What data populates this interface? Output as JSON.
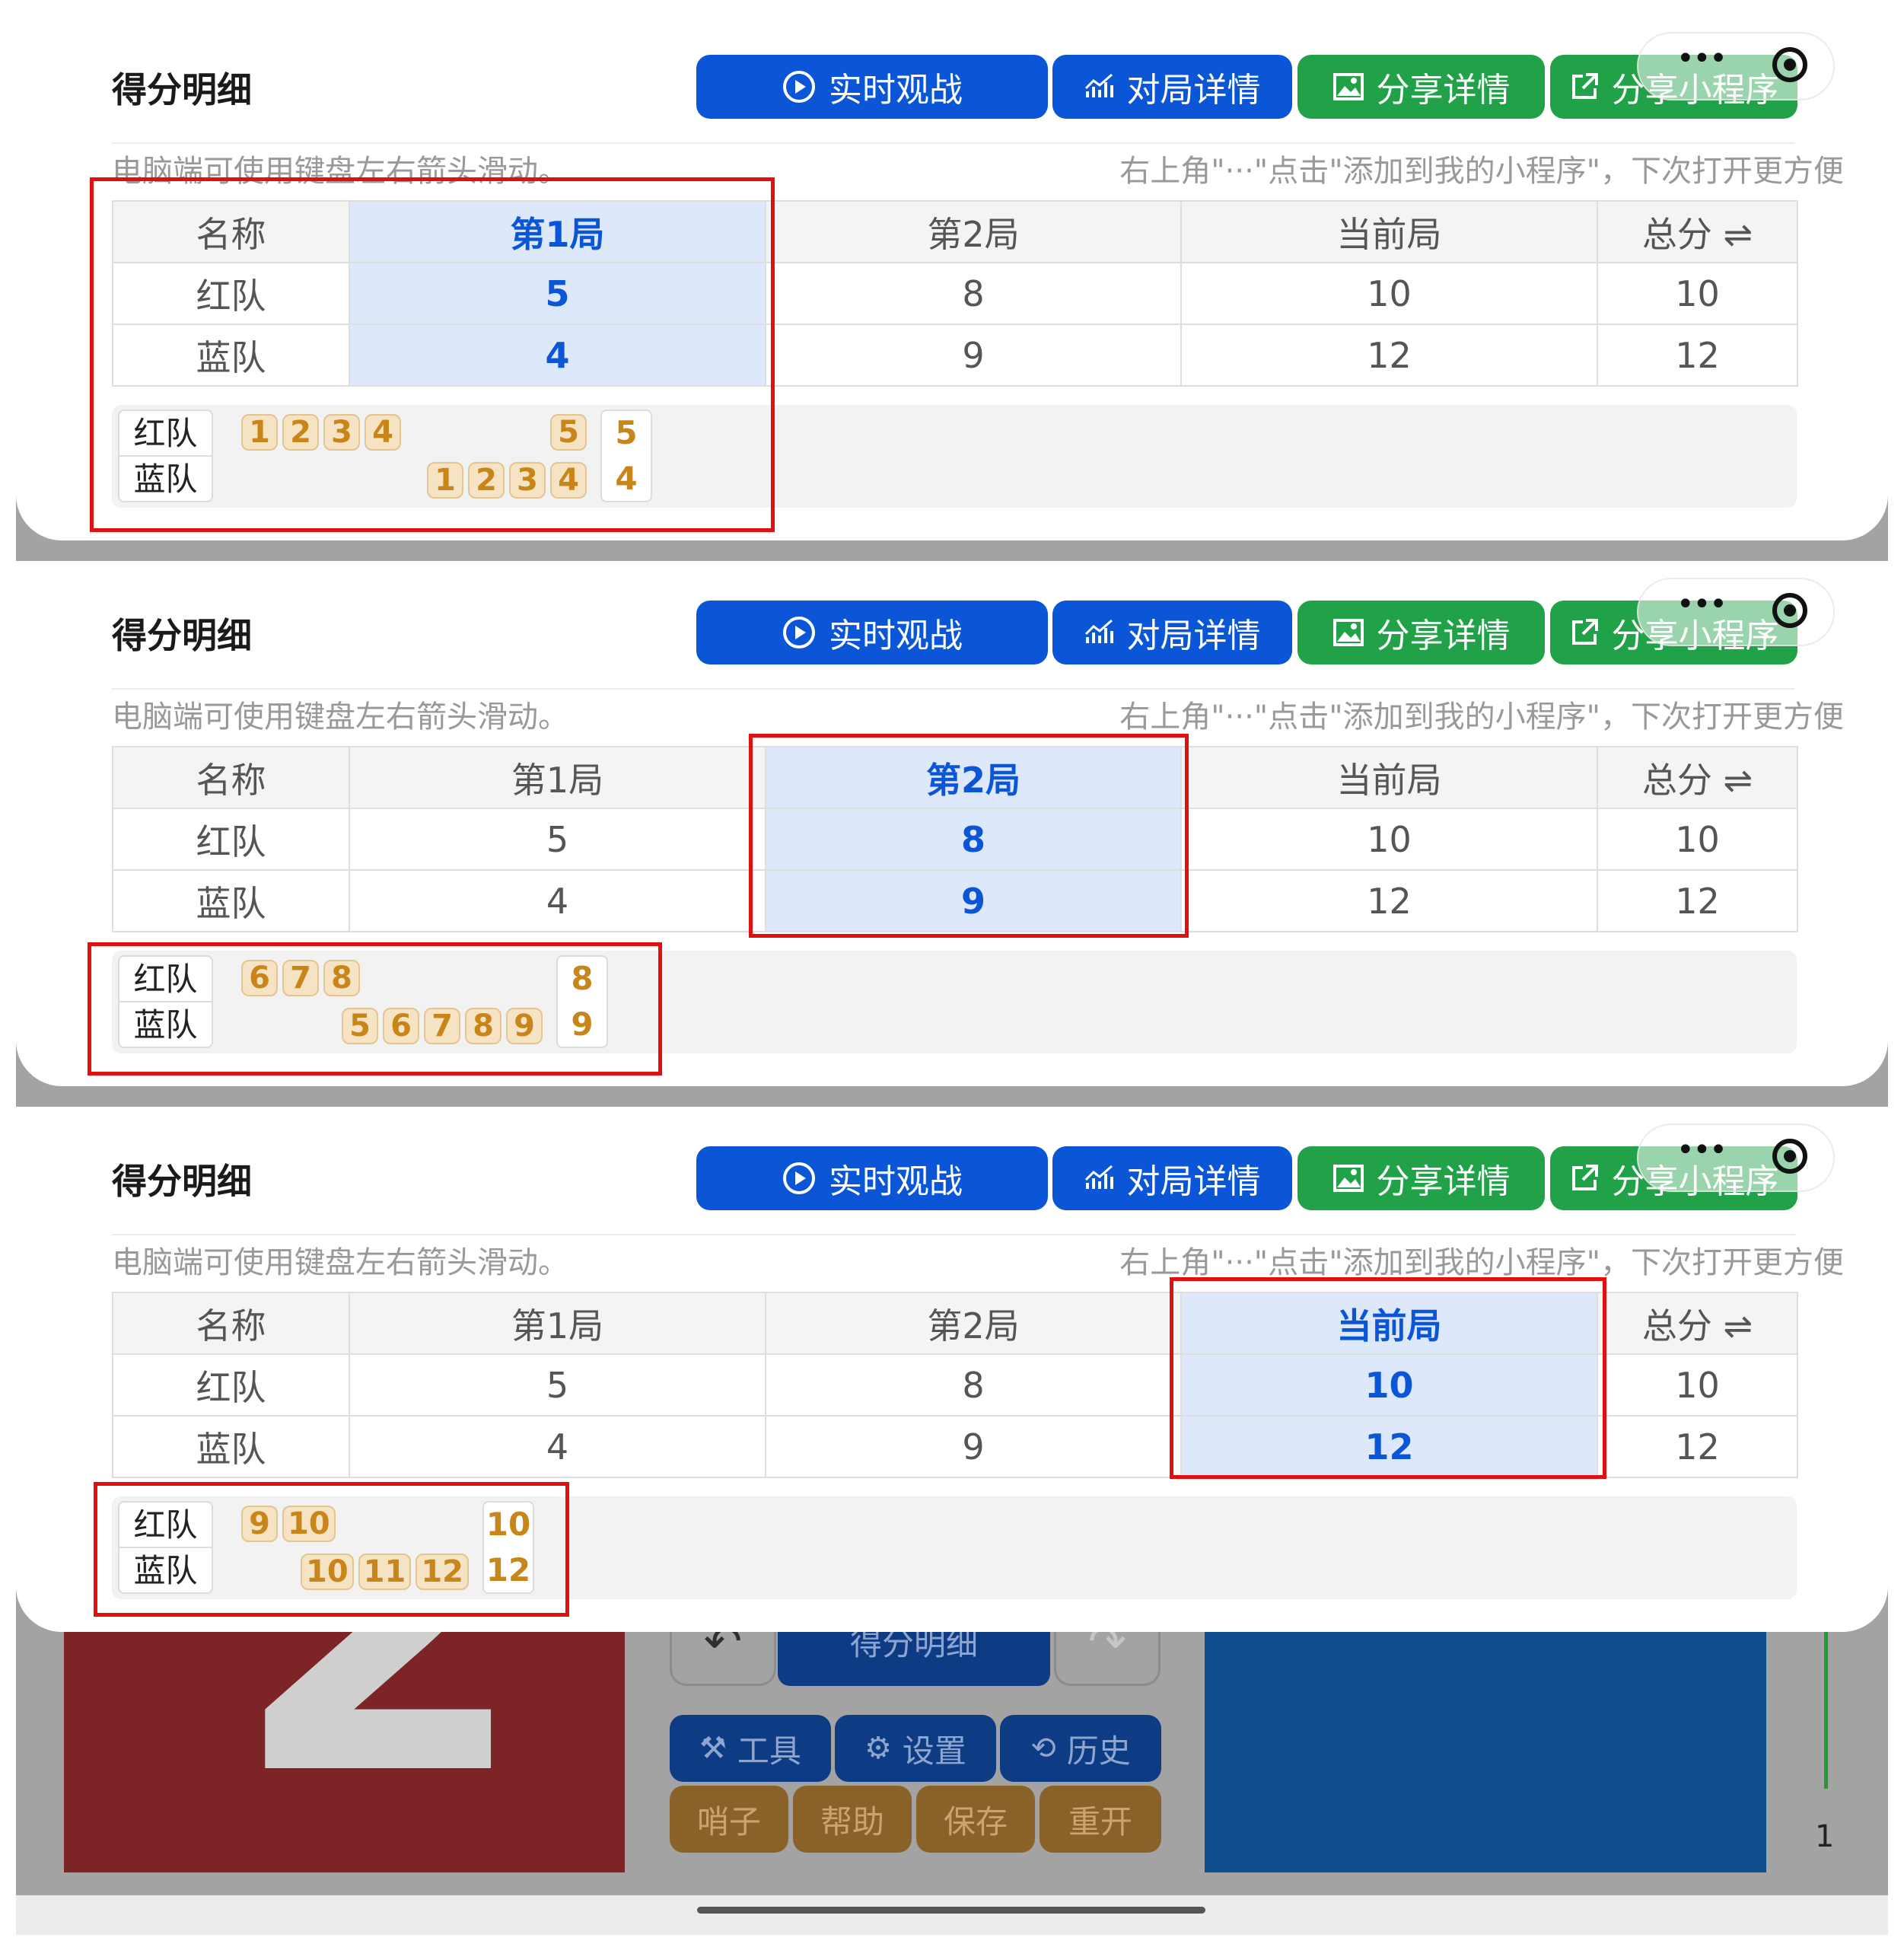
{
  "panels": [
    {
      "title": "得分明细",
      "buttons": {
        "live": "实时观战",
        "match": "对局详情",
        "share": "分享详情",
        "mini": "分享小程序"
      },
      "hint_left": "电脑端可使用键盘左右箭头滑动。",
      "hint_right": "右上角\"···\"点击\"添加到我的小程序\"，下次打开更方便",
      "columns": [
        "名称",
        "第1局",
        "第2局",
        "当前局",
        "总分 ⇌"
      ],
      "highlight_col": 1,
      "rows": [
        [
          "红队",
          "5",
          "8",
          "10",
          "10"
        ],
        [
          "蓝队",
          "4",
          "9",
          "12",
          "12"
        ]
      ],
      "seq": {
        "red_label": "红队",
        "blue_label": "蓝队",
        "red_chips": [
          "1",
          "2",
          "3",
          "4",
          "5"
        ],
        "blue_chips": [
          "1",
          "2",
          "3",
          "4"
        ],
        "red_total": "5",
        "blue_total": "4"
      }
    },
    {
      "title": "得分明细",
      "buttons": {
        "live": "实时观战",
        "match": "对局详情",
        "share": "分享详情",
        "mini": "分享小程序"
      },
      "hint_left": "电脑端可使用键盘左右箭头滑动。",
      "hint_right": "右上角\"···\"点击\"添加到我的小程序\"，下次打开更方便",
      "columns": [
        "名称",
        "第1局",
        "第2局",
        "当前局",
        "总分 ⇌"
      ],
      "highlight_col": 2,
      "rows": [
        [
          "红队",
          "5",
          "8",
          "10",
          "10"
        ],
        [
          "蓝队",
          "4",
          "9",
          "12",
          "12"
        ]
      ],
      "seq": {
        "red_label": "红队",
        "blue_label": "蓝队",
        "red_chips": [
          "6",
          "7",
          "8"
        ],
        "blue_chips": [
          "5",
          "6",
          "7",
          "8",
          "9"
        ],
        "red_total": "8",
        "blue_total": "9"
      }
    },
    {
      "title": "得分明细",
      "buttons": {
        "live": "实时观战",
        "match": "对局详情",
        "share": "分享详情",
        "mini": "分享小程序"
      },
      "hint_left": "电脑端可使用键盘左右箭头滑动。",
      "hint_right": "右上角\"···\"点击\"添加到我的小程序\"，下次打开更方便",
      "columns": [
        "名称",
        "第1局",
        "第2局",
        "当前局",
        "总分 ⇌"
      ],
      "highlight_col": 3,
      "rows": [
        [
          "红队",
          "5",
          "8",
          "10",
          "10"
        ],
        [
          "蓝队",
          "4",
          "9",
          "12",
          "12"
        ]
      ],
      "seq": {
        "red_label": "红队",
        "blue_label": "蓝队",
        "red_chips": [
          "9",
          "10"
        ],
        "blue_chips": [
          "10",
          "11",
          "12"
        ],
        "red_total": "10",
        "blue_total": "12"
      }
    }
  ],
  "background": {
    "red_score": "2",
    "score_detail_button": "得分明细",
    "undo_icon": "undo-icon",
    "redo_icon": "redo-icon",
    "tools": [
      "工具",
      "设置",
      "历史"
    ],
    "actions": [
      "哨子",
      "帮助",
      "保存",
      "重开"
    ],
    "page_number": "1"
  },
  "colors": {
    "blue_button": "#0a56d6",
    "green_button": "#21a148",
    "highlight": "#dde8fa",
    "annotation_red": "#e01010",
    "chip": "#c8861a"
  }
}
